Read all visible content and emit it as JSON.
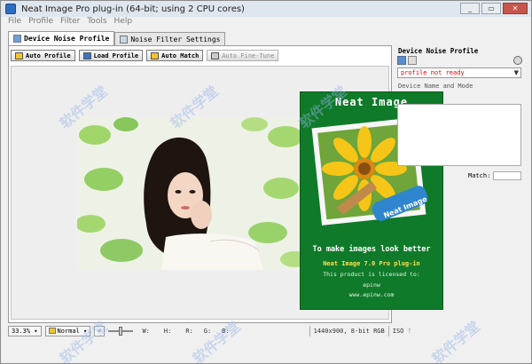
{
  "window": {
    "title": "Neat Image Pro plug-in (64-bit; using 2 CPU cores)",
    "controls": [
      "_",
      "▭",
      "✕"
    ]
  },
  "menu": [
    "File",
    "Profile",
    "Filter",
    "Tools",
    "Help"
  ],
  "tabs": [
    {
      "label": "Device Noise Profile",
      "active": true
    },
    {
      "label": "Noise Filter Settings",
      "active": false
    }
  ],
  "toolbar": {
    "auto_profile": "Auto Profile",
    "load_profile": "Load Profile",
    "auto_match": "Auto Match",
    "auto_fine_tune": "Auto Fine-Tune"
  },
  "splash": {
    "title": "Neat Image",
    "brush_label": "Neat Image",
    "tagline": "To make images look better",
    "product": "Neat Image 7.0 Pro plug-in",
    "licensed": "This product is licensed to:",
    "user": "epinw",
    "site": "www.epinw.com"
  },
  "right_panel": {
    "title": "Device Noise Profile",
    "profile_status": "profile not ready",
    "name_mode_label": "Device Name and Mode",
    "match_label": "Match:"
  },
  "statusbar": {
    "zoom": "33.3%",
    "mode": "Normal",
    "w": "W:",
    "h": "H:",
    "r": "R:",
    "g": "G:",
    "b": "B:",
    "image_info": "1440x900, 8-bit RGB",
    "iso": "ISO",
    "help": "?"
  },
  "watermark": "软件学堂",
  "colors": {
    "splash_bg": "#0f7a2a",
    "status_red": "#dd0000",
    "accent_yellow": "#ffe14a"
  }
}
